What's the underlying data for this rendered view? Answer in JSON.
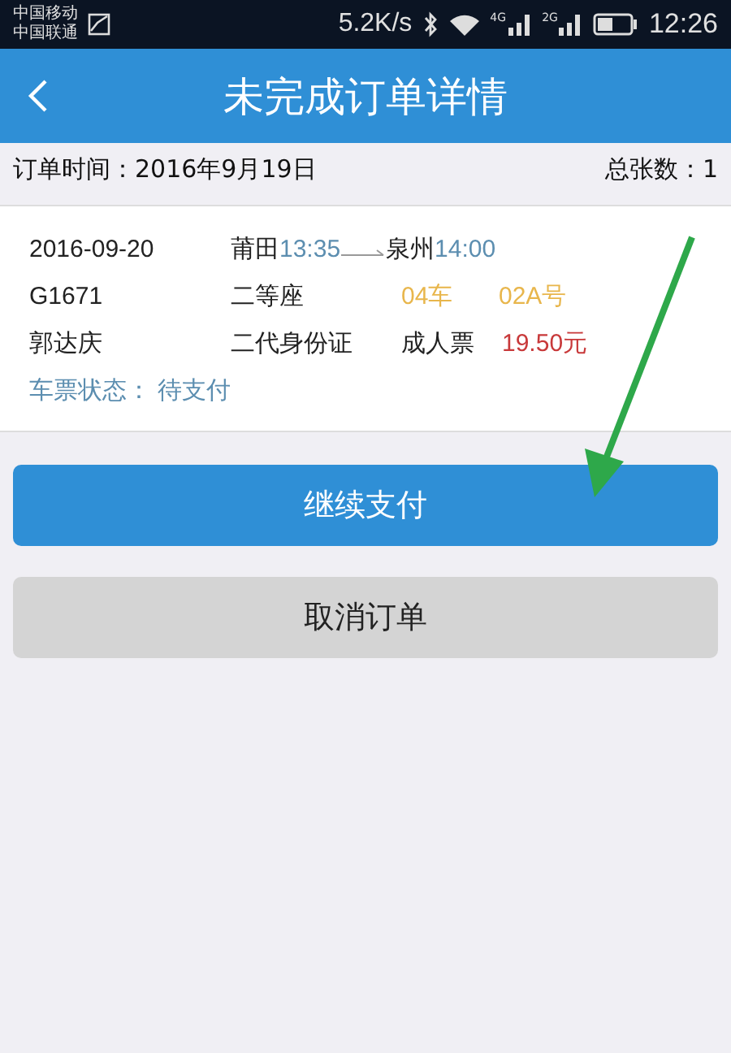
{
  "status_bar": {
    "carriers": [
      "中国移动",
      "中国联通"
    ],
    "speed": "5.2K/s",
    "signals": [
      "4G",
      "2G"
    ],
    "time": "12:26"
  },
  "header": {
    "title": "未完成订单详情"
  },
  "summary": {
    "order_time": "订单时间：2016年9月19日",
    "total": "总张数：1"
  },
  "ticket": {
    "date": "2016-09-20",
    "from": "莆田",
    "depart": "13:35",
    "to": "泉州",
    "arrive": "14:00",
    "train": "G1671",
    "seat_class": "二等座",
    "car": "04车",
    "seat": "02A号",
    "passenger": "郭达庆",
    "id_type": "二代身份证",
    "ticket_type": "成人票",
    "price": "19.50元",
    "status": "车票状态： 待支付"
  },
  "buttons": [
    {
      "label": "继续支付",
      "kind": "primary"
    },
    {
      "label": "取消订单",
      "kind": "secondary"
    }
  ]
}
